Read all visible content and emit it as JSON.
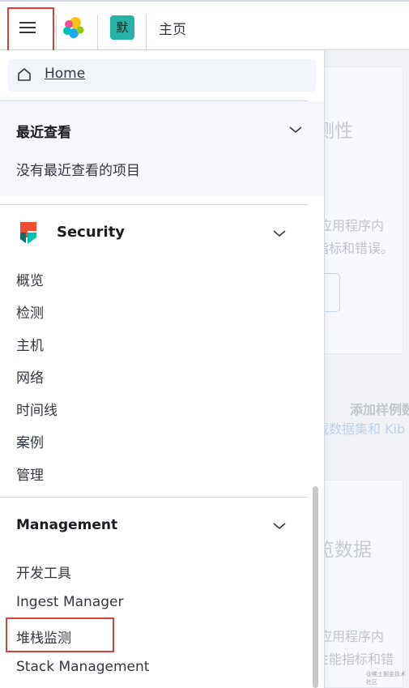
{
  "header": {
    "menu_icon": "hamburger-icon",
    "logo_icon": "elastic-logo-icon",
    "space_initial": "默",
    "breadcrumb": "主页"
  },
  "nav": {
    "home_label": "Home",
    "recent": {
      "title": "最近查看",
      "empty_message": "没有最近查看的项目"
    },
    "security": {
      "title": "Security",
      "items": [
        "概览",
        "检测",
        "主机",
        "网络",
        "时间线",
        "案例",
        "管理"
      ]
    },
    "management": {
      "title": "Management",
      "items": [
        "开发工具",
        "Ingest Manager",
        "堆栈监测",
        "Stack Management"
      ]
    }
  },
  "background_page": {
    "title_1_fragment": "测性",
    "desc_1_line1": "的应用程序内",
    "desc_1_line2": "指标和错误。",
    "sample_title_fragment": "添加样例数",
    "sample_link_fragment": "载数据集和 Kib",
    "title_2_fragment": "览数据",
    "desc_2_line1": "的应用程序内",
    "desc_2_line2": "性能指标和错",
    "watermark": "@稀土掘金技术社区"
  },
  "colors": {
    "highlight_box": "#d9413d",
    "space_badge": "#24b2a4",
    "link_blue": "#006bb4"
  }
}
